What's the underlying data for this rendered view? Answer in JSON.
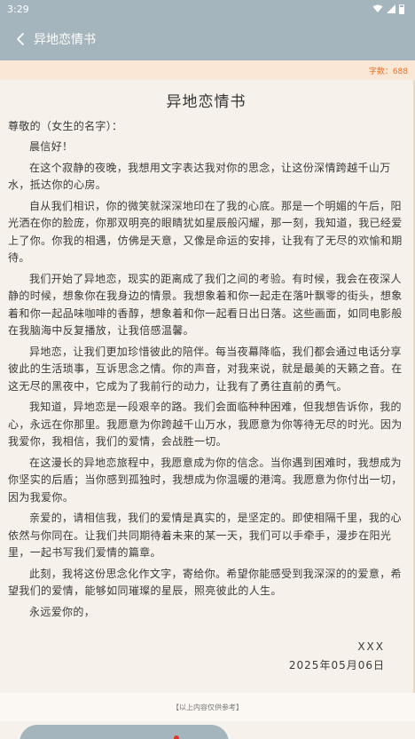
{
  "statusbar": {
    "time": "3:29"
  },
  "header": {
    "title": "异地恋情书"
  },
  "word_count": "字数：688",
  "letter": {
    "title": "异地恋情书",
    "greeting": "尊敬的（女生的名字）：",
    "paragraphs": [
      "晨信好！",
      "在这个寂静的夜晚，我想用文字表达我对你的思念，让这份深情跨越千山万水，抵达你的心房。",
      "自从我们相识，你的微笑就深深地印在了我的心底。那是一个明媚的午后，阳光洒在你的脸庞，你那双明亮的眼睛犹如星辰般闪耀，那一刻，我知道，我已经爱上了你。你我的相遇，仿佛是天意，又像是命运的安排，让我有了无尽的欢愉和期待。",
      "我们开始了异地恋，现实的距离成了我们之间的考验。有时候，我会在夜深人静的时候，想象你在我身边的情景。我想象着和你一起走在落叶飘零的街头，想象着和你一起品味咖啡的香醇，想象着和你一起看日出日落。这些画面，如同电影般在我脑海中反复播放，让我倍感温馨。",
      "异地恋，让我们更加珍惜彼此的陪伴。每当夜幕降临，我们都会通过电话分享彼此的生活琐事，互诉思念之情。你的声音，对我来说，就是最美的天籁之音。在这无尽的黑夜中，它成为了我前行的动力，让我有了勇往直前的勇气。",
      "我知道，异地恋是一段艰辛的路。我们会面临种种困难，但我想告诉你，我的心，永远在你那里。我愿意为你跨越千山万水，我愿意为你等待无尽的时光。因为我爱你，我相信，我们的爱情，会战胜一切。",
      "在这漫长的异地恋旅程中，我愿意成为你的信念。当你遇到困难时，我想成为你坚实的后盾；当你感到孤独时，我想成为你温暖的港湾。我愿意为你付出一切，因为我爱你。",
      "亲爱的，请相信我，我们的爱情是真实的，是坚定的。即使相隔千里，我的心依然与你同在。让我们共同期待着未来的某一天，我们可以手牵手，漫步在阳光里，一起书写我们爱情的篇章。",
      "此刻，我将这份思念化作文字，寄给你。希望你能感受到我深深的的爱意，希望我们的爱情，能够如同璀璨的星辰，照亮彼此的人生。",
      "永远爱你的，"
    ],
    "signature": "XXX",
    "date": "2025年05月06日"
  },
  "footer_note": "【以上内容仅供参考】",
  "colors": {
    "accent": "#a5b5bd",
    "count": "#e8732a",
    "background": "#f6f1ea"
  }
}
